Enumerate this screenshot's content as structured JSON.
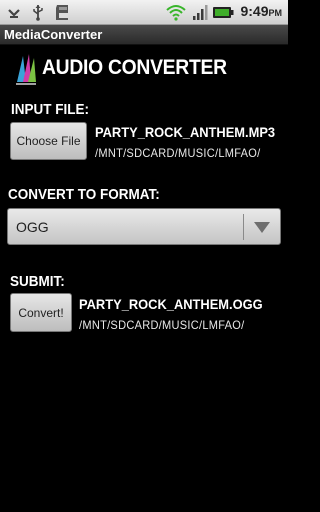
{
  "status_bar": {
    "time": "9:49",
    "time_suffix": "PM",
    "icons": [
      "usb-debug-icon",
      "usb-icon",
      "sd-card-icon",
      "wifi-icon",
      "signal-icon",
      "battery-icon"
    ]
  },
  "app": {
    "title": "MediaConverter",
    "heading": "AUDIO CONVERTER"
  },
  "input_section": {
    "label": "INPUT FILE:",
    "button_label": "Choose File",
    "file_name": "PARTY_ROCK_ANTHEM.MP3",
    "file_path": "/MNT/SDCARD/MUSIC/LMFAO/"
  },
  "format_section": {
    "label": "CONVERT TO FORMAT:",
    "selected": "OGG"
  },
  "submit_section": {
    "label": "SUBMIT:",
    "button_label": "Convert!",
    "file_name": "PARTY_ROCK_ANTHEM.OGG",
    "file_path": "/MNT/SDCARD/MUSIC/LMFAO/"
  },
  "colors": {
    "background": "#000000",
    "status_bar": "#dcdcdc",
    "battery_green": "#3fae2a",
    "wifi_green": "#38b52a"
  }
}
